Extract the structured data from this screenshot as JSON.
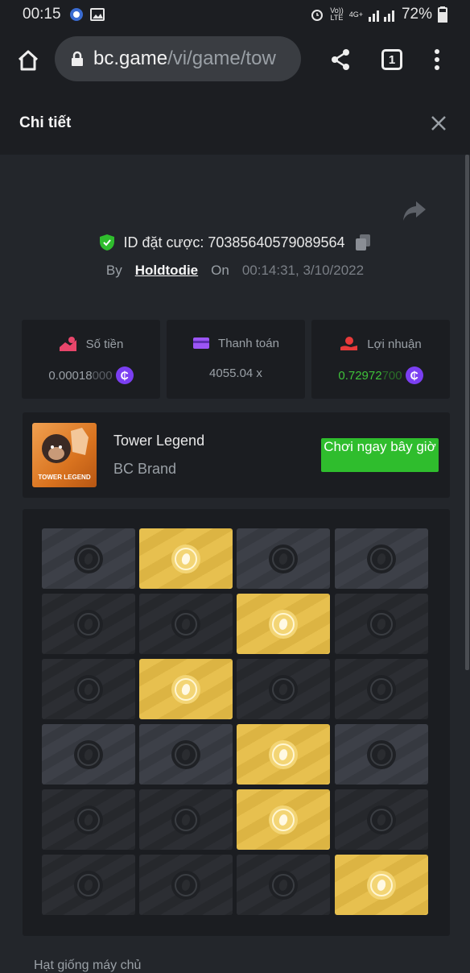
{
  "status_bar": {
    "time": "00:15",
    "network_labels": [
      "Vo))",
      "LTE",
      "4G+"
    ],
    "battery": "72%"
  },
  "browser": {
    "url_host": "bc.game",
    "url_path": "/vi/game/tow",
    "tab_count": "1"
  },
  "panel": {
    "title": "Chi tiết"
  },
  "bet": {
    "id_label": "ID đặt cược:",
    "id_value": "70385640579089564",
    "by_label": "By",
    "username": "Holdtodie",
    "on_label": "On",
    "datetime": "00:14:31, 3/10/2022"
  },
  "stats": [
    {
      "label": "Số tiền",
      "value_main": "0.00018",
      "value_tail": "000",
      "value_color": "#9aa0a6",
      "icon": "bet-amount-icon",
      "has_coin": true
    },
    {
      "label": "Thanh toán",
      "value_main": "4055.04 x",
      "value_tail": "",
      "value_color": "#9aa0a6",
      "icon": "wallet-icon",
      "has_coin": false
    },
    {
      "label": "Lợi nhuận",
      "value_main": "0.72972",
      "value_tail": "700",
      "value_color": "#3fc23a",
      "icon": "profit-icon",
      "has_coin": true
    }
  ],
  "game": {
    "thumb_label": "TOWER LEGEND",
    "name": "Tower Legend",
    "brand": "BC Brand",
    "play_label": "Chơi ngay bây giờ"
  },
  "board": {
    "rows": [
      [
        "light",
        "gold",
        "light",
        "light"
      ],
      [
        "dark",
        "dark",
        "gold",
        "dark"
      ],
      [
        "dark",
        "gold",
        "dark",
        "dark"
      ],
      [
        "light",
        "light",
        "gold",
        "light"
      ],
      [
        "dark",
        "dark",
        "gold",
        "dark"
      ],
      [
        "dark",
        "dark",
        "dark",
        "gold"
      ]
    ]
  },
  "footer": {
    "text": "Hạt giống máy chủ"
  },
  "colors": {
    "accent_green": "#2fbd2d",
    "coin_purple": "#7b3ff2",
    "gold_tile": "#e7c04f",
    "shield_green": "#2fbd2d",
    "profit_green": "#3fc23a"
  }
}
